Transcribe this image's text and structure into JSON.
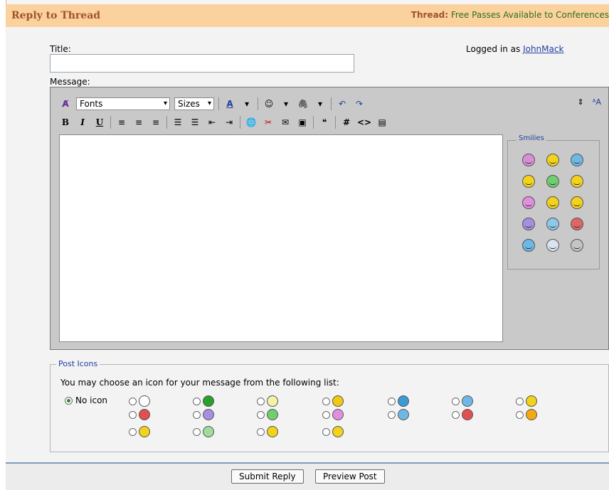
{
  "header": {
    "title": "Reply to Thread",
    "thread_label": "Thread:",
    "thread_name": "Free Passes Available to Conferences"
  },
  "form": {
    "title_label": "Title:",
    "title_value": "",
    "logged_in_text": "Logged in as",
    "username": "JohnMack",
    "message_label": "Message:"
  },
  "toolbar": {
    "font_select": "Fonts",
    "size_select": "Sizes",
    "bold": "B",
    "italic": "I",
    "underline": "U",
    "hash": "#",
    "code": "<>"
  },
  "smilies": {
    "legend": "Smilies",
    "items": [
      {
        "icon": "tongue-smiley-icon",
        "color": "#d88fd8"
      },
      {
        "icon": "wink-smiley-icon",
        "color": "#f2d21b"
      },
      {
        "icon": "cool-smiley-icon",
        "color": "#6fb8e6"
      },
      {
        "icon": "sleep-smiley-icon",
        "color": "#f2d21b"
      },
      {
        "icon": "grin-smiley-icon",
        "color": "#6fcf6f"
      },
      {
        "icon": "love-smiley-icon",
        "color": "#f2d21b"
      },
      {
        "icon": "happy-smiley-icon",
        "color": "#e08fe0"
      },
      {
        "icon": "big-smile-icon",
        "color": "#f2d21b"
      },
      {
        "icon": "smile-icon",
        "color": "#f2d21b"
      },
      {
        "icon": "sad-smiley-icon",
        "color": "#a78fe0"
      },
      {
        "icon": "confused-smiley-icon",
        "color": "#8fc8ea"
      },
      {
        "icon": "mad-smiley-icon",
        "color": "#e06666"
      },
      {
        "icon": "rolleyes-smiley-icon",
        "color": "#6fb8e6"
      },
      {
        "icon": "sunglasses-smiley-icon",
        "color": "#d9e4ef"
      },
      {
        "icon": "shocked-smiley-icon",
        "color": "#c5c5c5"
      }
    ]
  },
  "post_icons": {
    "legend": "Post Icons",
    "hint": "You may choose an icon for your message from the following list:",
    "no_icon_label": "No icon",
    "items": [
      {
        "icon": "document-icon",
        "color": "#ffffff"
      },
      {
        "icon": "arrow-icon",
        "color": "#2aa02a"
      },
      {
        "icon": "lightbulb-icon",
        "color": "#f4f1a8"
      },
      {
        "icon": "warning-icon",
        "color": "#f2c812"
      },
      {
        "icon": "question-icon",
        "color": "#3b9ad6"
      },
      {
        "icon": "cool-icon",
        "color": "#6fb8e6"
      },
      {
        "icon": "smile-icon",
        "color": "#f2d21b"
      },
      {
        "icon": "angry-icon",
        "color": "#e05050"
      },
      {
        "icon": "sad-icon",
        "color": "#a78fe0"
      },
      {
        "icon": "grin-icon",
        "color": "#6fcf6f"
      },
      {
        "icon": "happy-icon",
        "color": "#e08fe0"
      },
      {
        "icon": "wink-icon",
        "color": "#6fb8e6"
      },
      {
        "icon": "thumbs-down-icon",
        "color": "#e05050"
      },
      {
        "icon": "thumbs-up-icon",
        "color": "#f2a912"
      },
      {
        "icon": "talking-smiley-icon",
        "color": "#f2d21b"
      },
      {
        "icon": "alien-icon",
        "color": "#9fdc9f"
      },
      {
        "icon": "laughing-icon",
        "color": "#f2d21b"
      },
      {
        "icon": "rock-on-icon",
        "color": "#f2d21b"
      }
    ]
  },
  "buttons": {
    "submit": "Submit Reply",
    "preview": "Preview Post"
  }
}
